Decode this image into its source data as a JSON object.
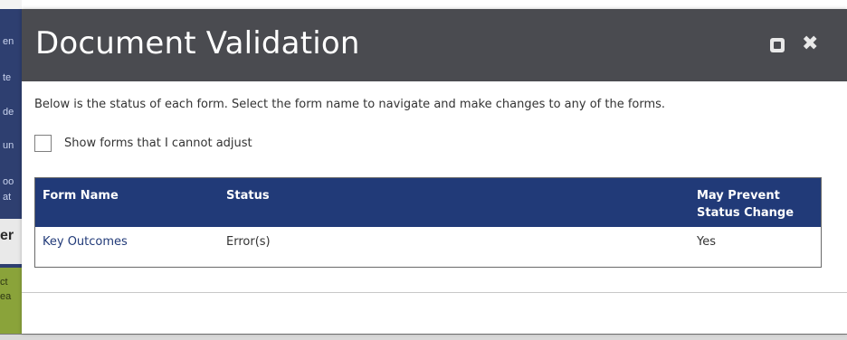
{
  "background": {
    "partial_texts": [
      "en",
      "te",
      "de",
      "un",
      "oo",
      "at",
      "er",
      "ct",
      "ea"
    ]
  },
  "dialog": {
    "title": "Document Validation",
    "maximize_icon": "maximize-icon",
    "close_icon": "close-icon",
    "close_glyph": "✖",
    "intro": "Below is the status of each form. Select the form name to navigate and make changes to any of the forms.",
    "show_forms_label": "Show forms that I cannot adjust",
    "show_forms_checked": false,
    "table": {
      "headers": {
        "form_name": "Form Name",
        "status": "Status",
        "may_prevent": "May Prevent Status Change"
      },
      "rows": [
        {
          "form_name": "Key Outcomes",
          "status": "Error(s)",
          "may_prevent": "Yes"
        }
      ]
    }
  },
  "colors": {
    "header_bg": "#4a4b50",
    "table_header_bg": "#213a78",
    "link": "#213a78",
    "background_nav": "#2e3f70",
    "background_accent": "#8aa33a"
  }
}
